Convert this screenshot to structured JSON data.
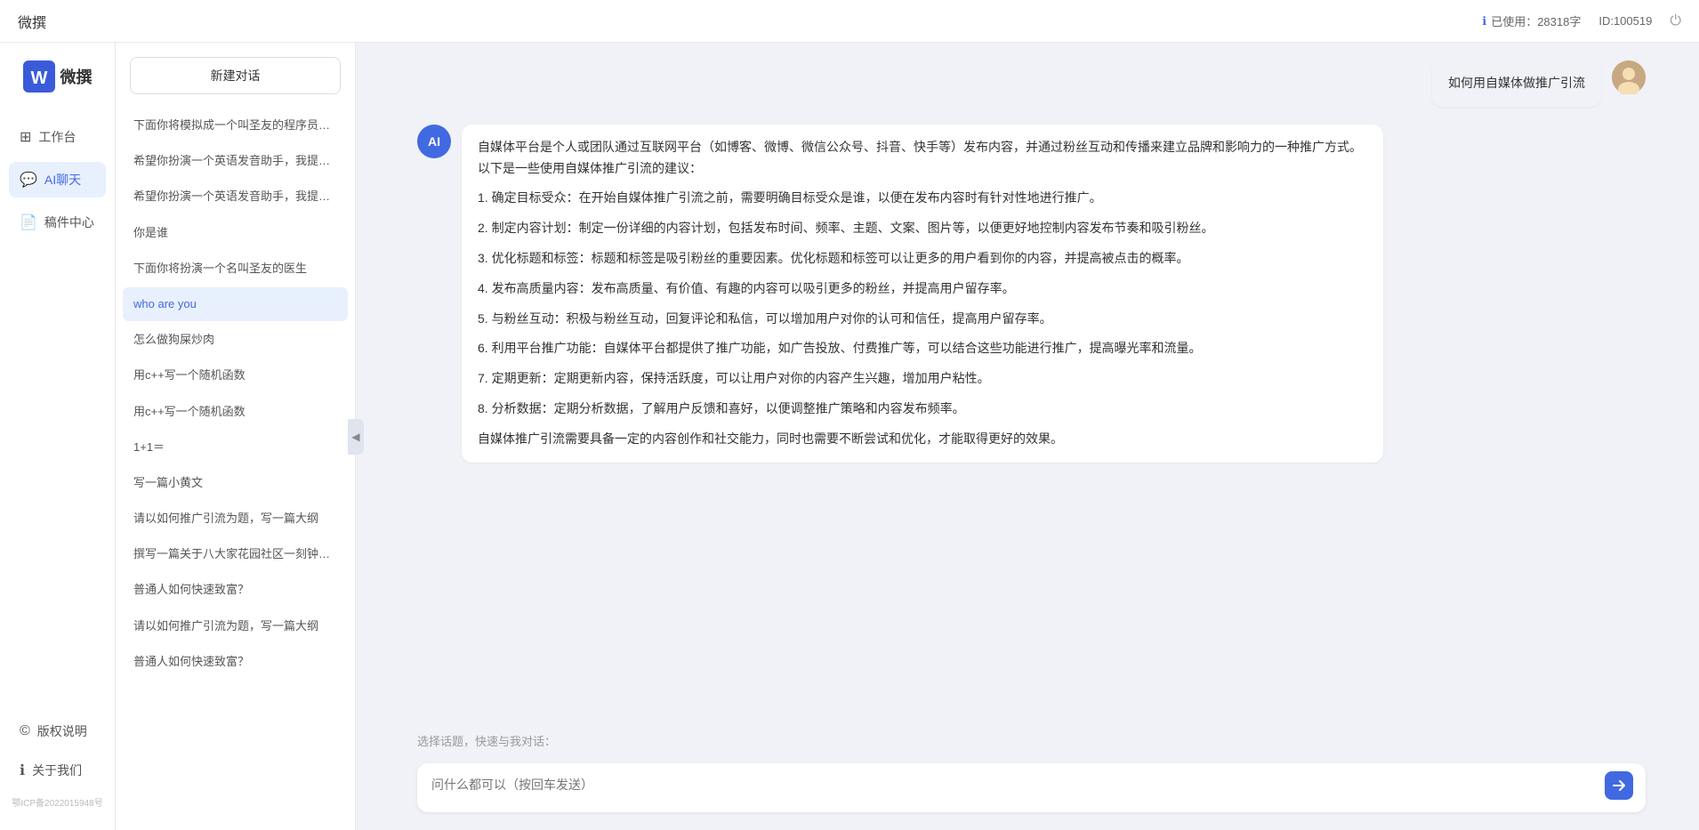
{
  "topbar": {
    "title": "微撰",
    "usage_label": "已使用：28318字",
    "id_label": "ID:100519",
    "usage_icon": "ℹ"
  },
  "logo": {
    "text": "微撰"
  },
  "nav": {
    "items": [
      {
        "id": "workbench",
        "label": "工作台",
        "icon": "⊞"
      },
      {
        "id": "ai-chat",
        "label": "AI聊天",
        "icon": "💬"
      },
      {
        "id": "draft",
        "label": "稿件中心",
        "icon": "📄"
      }
    ],
    "bottom_items": [
      {
        "id": "copyright",
        "label": "版权说明",
        "icon": "©"
      },
      {
        "id": "about",
        "label": "关于我们",
        "icon": "ℹ"
      }
    ],
    "copyright_text": "鄂ICP备2022015948号"
  },
  "sidebar": {
    "new_chat": "新建对话",
    "history": [
      {
        "id": 1,
        "text": "下面你将模拟成一个叫圣友的程序员、我说...",
        "active": false
      },
      {
        "id": 2,
        "text": "希望你扮演一个英语发音助手，我提供给你...",
        "active": false
      },
      {
        "id": 3,
        "text": "希望你扮演一个英语发音助手，我提供给你...",
        "active": false
      },
      {
        "id": 4,
        "text": "你是谁",
        "active": false
      },
      {
        "id": 5,
        "text": "下面你将扮演一个名叫圣友的医生",
        "active": false
      },
      {
        "id": 6,
        "text": "who are you",
        "active": true
      },
      {
        "id": 7,
        "text": "怎么做狗屎炒肉",
        "active": false
      },
      {
        "id": 8,
        "text": "用c++写一个随机函数",
        "active": false
      },
      {
        "id": 9,
        "text": "用c++写一个随机函数",
        "active": false
      },
      {
        "id": 10,
        "text": "1+1＝",
        "active": false
      },
      {
        "id": 11,
        "text": "写一篇小黄文",
        "active": false
      },
      {
        "id": 12,
        "text": "请以如何推广引流为题，写一篇大纲",
        "active": false
      },
      {
        "id": 13,
        "text": "撰写一篇关于八大家花园社区一刻钟便民生...",
        "active": false
      },
      {
        "id": 14,
        "text": "普通人如何快速致富？",
        "active": false
      },
      {
        "id": 15,
        "text": "请以如何推广引流为题，写一篇大纲",
        "active": false
      },
      {
        "id": 16,
        "text": "普通人如何快速致富？",
        "active": false
      }
    ]
  },
  "chat": {
    "messages": [
      {
        "id": 1,
        "role": "user",
        "avatar_type": "user",
        "text": "如何用自媒体做推广引流"
      },
      {
        "id": 2,
        "role": "ai",
        "avatar_type": "ai",
        "paragraphs": [
          "自媒体平台是个人或团队通过互联网平台（如博客、微博、微信公众号、抖音、快手等）发布内容，并通过粉丝互动和传播来建立品牌和影响力的一种推广方式。以下是一些使用自媒体推广引流的建议：",
          "1. 确定目标受众：在开始自媒体推广引流之前，需要明确目标受众是谁，以便在发布内容时有针对性地进行推广。",
          "2. 制定内容计划：制定一份详细的内容计划，包括发布时间、频率、主题、文案、图片等，以便更好地控制内容发布节奏和吸引粉丝。",
          "3. 优化标题和标签：标题和标签是吸引粉丝的重要因素。优化标题和标签可以让更多的用户看到你的内容，并提高被点击的概率。",
          "4. 发布高质量内容：发布高质量、有价值、有趣的内容可以吸引更多的粉丝，并提高用户留存率。",
          "5. 与粉丝互动：积极与粉丝互动，回复评论和私信，可以增加用户对你的认可和信任，提高用户留存率。",
          "6. 利用平台推广功能：自媒体平台都提供了推广功能，如广告投放、付费推广等，可以结合这些功能进行推广，提高曝光率和流量。",
          "7. 定期更新：定期更新内容，保持活跃度，可以让用户对你的内容产生兴趣，增加用户粘性。",
          "8. 分析数据：定期分析数据，了解用户反馈和喜好，以便调整推广策略和内容发布频率。",
          "自媒体推广引流需要具备一定的内容创作和社交能力，同时也需要不断尝试和优化，才能取得更好的效果。"
        ]
      }
    ],
    "topic_label": "选择话题，快速与我对话：",
    "input_placeholder": "问什么都可以（按回车发送）"
  }
}
